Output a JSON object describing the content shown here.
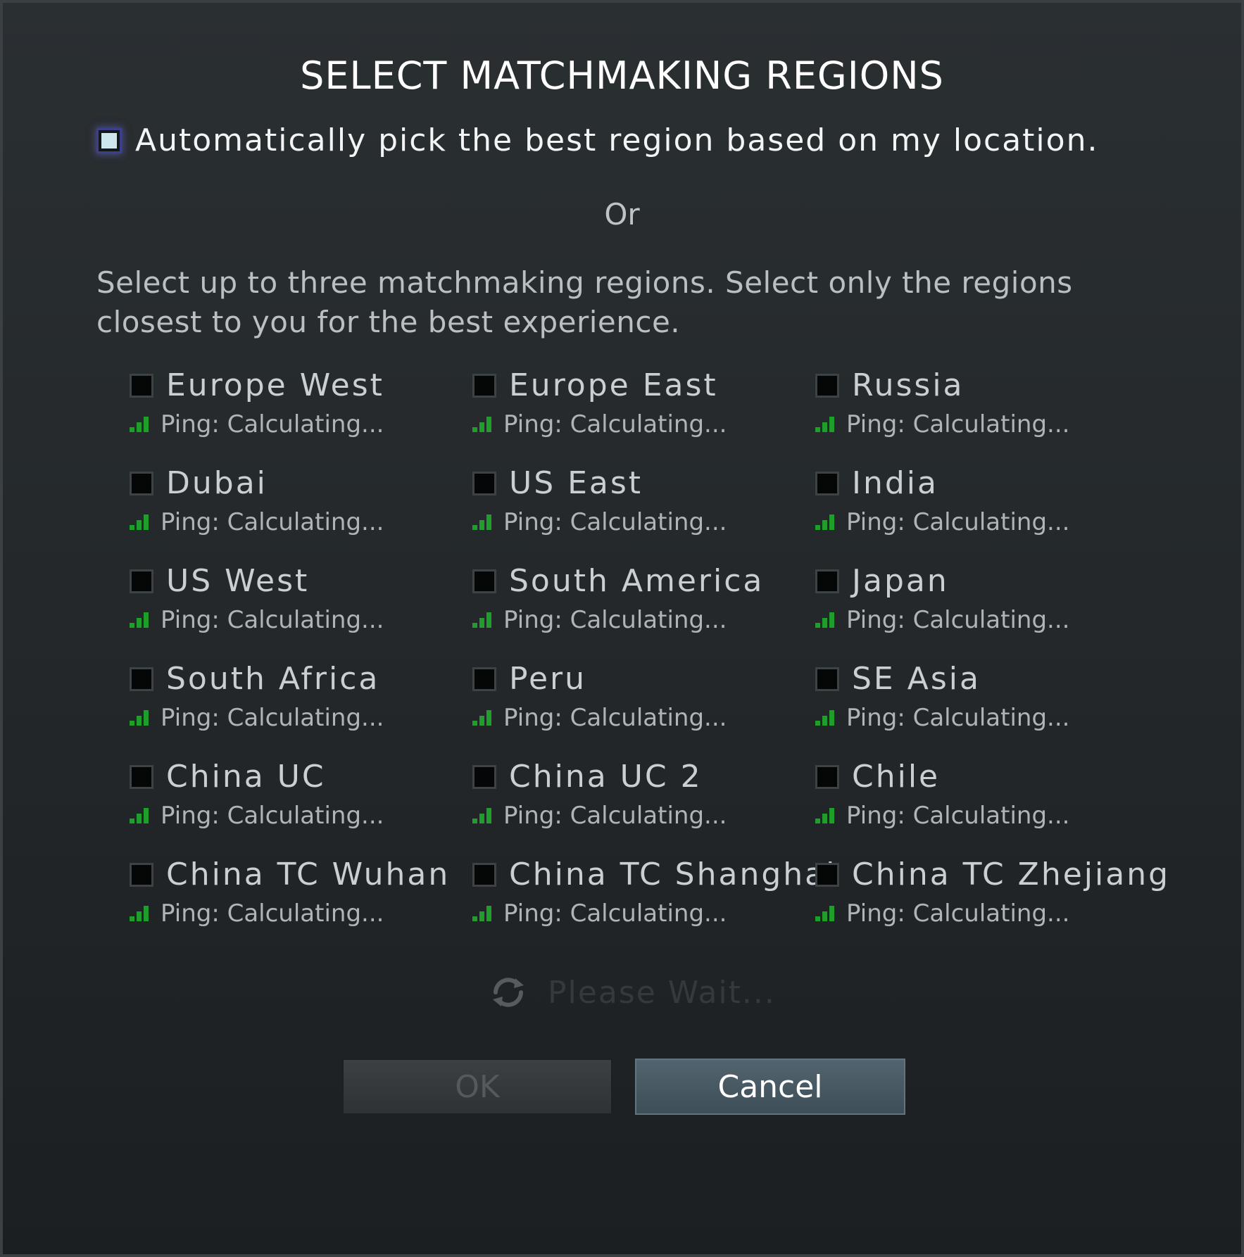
{
  "dialog": {
    "title": "SELECT MATCHMAKING REGIONS",
    "auto_pick_label": "Automatically pick the best region based on my location.",
    "auto_pick_checked": true,
    "or_text": "Or",
    "instructions": "Select up to three matchmaking regions. Select only the regions closest to you for the best experience."
  },
  "regions": [
    {
      "name": "Europe West",
      "ping": "Ping: Calculating..."
    },
    {
      "name": "Europe East",
      "ping": "Ping: Calculating..."
    },
    {
      "name": "Russia",
      "ping": "Ping: Calculating..."
    },
    {
      "name": "Dubai",
      "ping": "Ping: Calculating..."
    },
    {
      "name": "US East",
      "ping": "Ping: Calculating..."
    },
    {
      "name": "India",
      "ping": "Ping: Calculating..."
    },
    {
      "name": "US West",
      "ping": "Ping: Calculating..."
    },
    {
      "name": "South America",
      "ping": "Ping: Calculating..."
    },
    {
      "name": "Japan",
      "ping": "Ping: Calculating..."
    },
    {
      "name": "South Africa",
      "ping": "Ping: Calculating..."
    },
    {
      "name": "Peru",
      "ping": "Ping: Calculating..."
    },
    {
      "name": "SE Asia",
      "ping": "Ping: Calculating..."
    },
    {
      "name": "China UC",
      "ping": "Ping: Calculating..."
    },
    {
      "name": "China UC 2",
      "ping": "Ping: Calculating..."
    },
    {
      "name": "Chile",
      "ping": "Ping: Calculating..."
    },
    {
      "name": "China TC Wuhan",
      "ping": "Ping: Calculating..."
    },
    {
      "name": "China TC Shanghai",
      "ping": "Ping: Calculating..."
    },
    {
      "name": "China TC Zhejiang",
      "ping": "Ping: Calculating..."
    }
  ],
  "status": {
    "wait_text": "Please Wait..."
  },
  "buttons": {
    "ok_label": "OK",
    "cancel_label": "Cancel"
  },
  "colors": {
    "ping_bars": "#1f9e2b",
    "cancel_button": "#4a5b66",
    "ok_button_disabled": "#34383b"
  }
}
